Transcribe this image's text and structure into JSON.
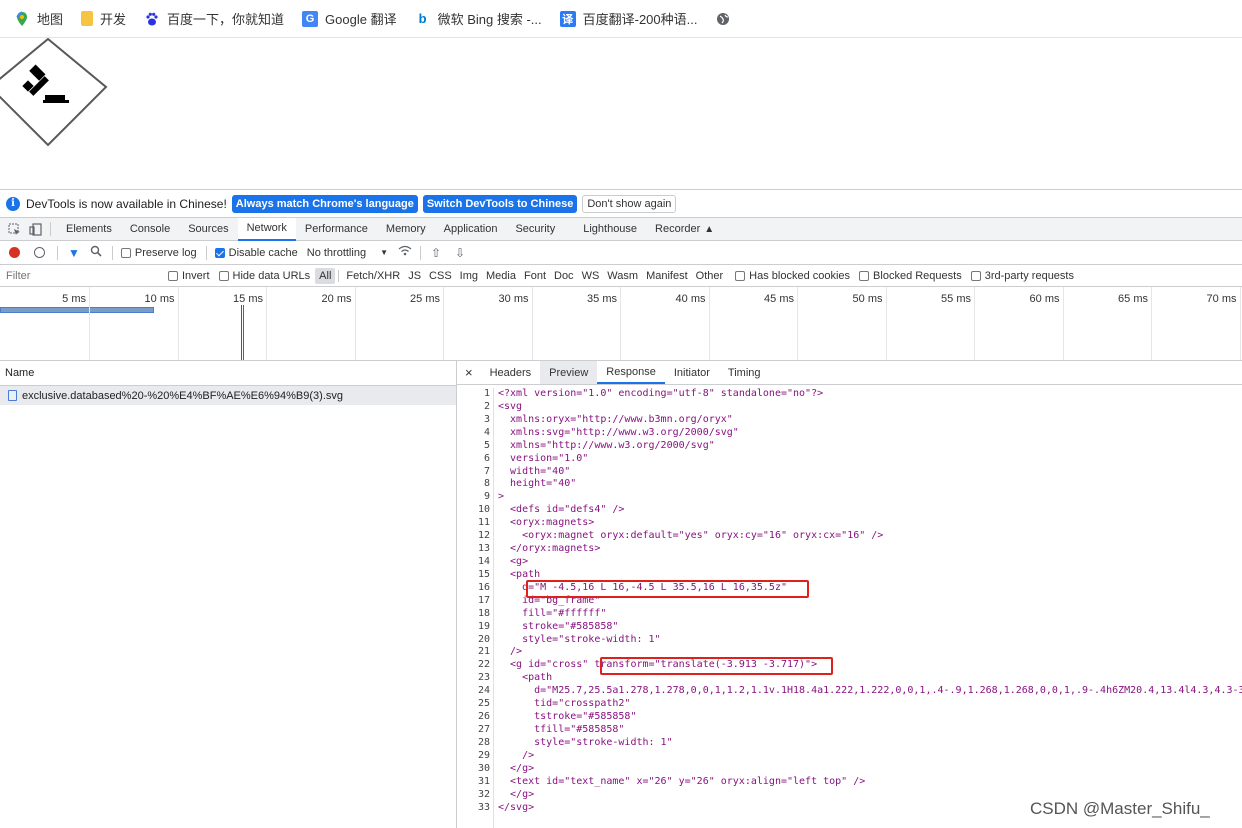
{
  "bookmarks": [
    {
      "label": "地图",
      "icon": "maps-icon",
      "color": "#34a853"
    },
    {
      "label": "开发",
      "icon": "folder-icon",
      "color": "#f5c542"
    },
    {
      "label": "百度一下，你就知道",
      "icon": "baidu-paw-icon",
      "color": "#2932e1"
    },
    {
      "label": "Google 翻译",
      "icon": "google-translate-icon",
      "color": "#4285f4"
    },
    {
      "label": "微软 Bing 搜索 -...",
      "icon": "bing-icon",
      "color": "#0078d4"
    },
    {
      "label": "百度翻译-200种语...",
      "icon": "baidu-translate-icon",
      "color": "#2b7bf6"
    }
  ],
  "infobar": {
    "message": "DevTools is now available in Chinese!",
    "btn_match": "Always match Chrome's language",
    "btn_switch": "Switch DevTools to Chinese",
    "btn_dont": "Don't show again"
  },
  "tabs": [
    "Elements",
    "Console",
    "Sources",
    "Network",
    "Performance",
    "Memory",
    "Application",
    "Security",
    "Lighthouse",
    "Recorder"
  ],
  "controls": {
    "preserve_log": "Preserve log",
    "disable_cache": "Disable cache",
    "throttling": "No throttling"
  },
  "filter": {
    "placeholder": "Filter",
    "invert": "Invert",
    "hide_urls": "Hide data URLs",
    "types": [
      "All",
      "Fetch/XHR",
      "JS",
      "CSS",
      "Img",
      "Media",
      "Font",
      "Doc",
      "WS",
      "Wasm",
      "Manifest",
      "Other"
    ],
    "blocked_cookies": "Has blocked cookies",
    "blocked_requests": "Blocked Requests",
    "third_party": "3rd-party requests"
  },
  "timeline_ticks": [
    "5 ms",
    "10 ms",
    "15 ms",
    "20 ms",
    "25 ms",
    "30 ms",
    "35 ms",
    "40 ms",
    "45 ms",
    "50 ms",
    "55 ms",
    "60 ms",
    "65 ms",
    "70 ms"
  ],
  "requests": {
    "header": "Name",
    "rows": [
      "exclusive.databased%20-%20%E4%BF%AE%E6%94%B9(3).svg"
    ]
  },
  "detail_tabs": [
    "Headers",
    "Preview",
    "Response",
    "Initiator",
    "Timing"
  ],
  "close_symbol": "×",
  "response_lines": [
    "<?xml version=\"1.0\" encoding=\"utf-8\" standalone=\"no\"?>",
    "<svg",
    "  xmlns:oryx=\"http://www.b3mn.org/oryx\"",
    "  xmlns:svg=\"http://www.w3.org/2000/svg\"",
    "  xmlns=\"http://www.w3.org/2000/svg\"",
    "  version=\"1.0\"",
    "  width=\"40\"",
    "  height=\"40\"",
    ">",
    "  <defs id=\"defs4\" />",
    "  <oryx:magnets>",
    "    <oryx:magnet oryx:default=\"yes\" oryx:cy=\"16\" oryx:cx=\"16\" />",
    "  </oryx:magnets>",
    "  <g>",
    "  <path",
    "    d=\"M -4.5,16 L 16,-4.5 L 35.5,16 L 16,35.5z\"",
    "    id=\"bg_frame\"",
    "    fill=\"#ffffff\"",
    "    stroke=\"#585858\"",
    "    style=\"stroke-width: 1\"",
    "  />",
    "  <g id=\"cross\" transform=\"translate(-3.913 -3.717)\">",
    "    <path",
    "      d=\"M25.7,25.5a1.278,1.278,0,0,1,1.2,1.1v.1H18.4a1.222,1.222,0,0,1,.4-.9,1.268,1.268,0,0,1,.9-.4h6ZM20.4,13.4l4.3,4.3-3",
    "      tid=\"crosspath2\"",
    "      tstroke=\"#585858\"",
    "      tfill=\"#585858\"",
    "      style=\"stroke-width: 1\"",
    "    />",
    "  </g>",
    "  <text id=\"text_name\" x=\"26\" y=\"26\" oryx:align=\"left top\" />",
    "  </g>",
    "</svg>"
  ],
  "watermark": "CSDN @Master_Shifu_"
}
